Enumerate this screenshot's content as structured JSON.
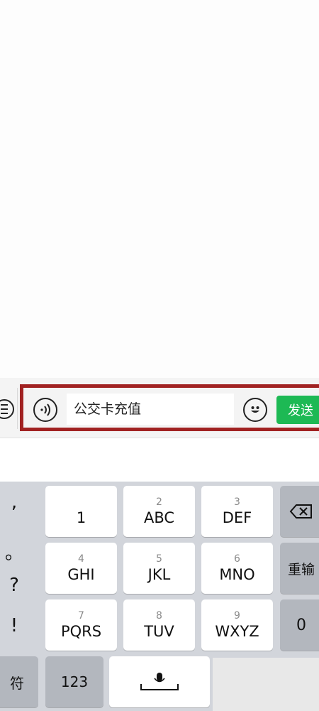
{
  "input_bar": {
    "text_value": "公交卡充值",
    "send_label": "发送"
  },
  "icons": {
    "menu": "menu-lines-icon",
    "voice": "voice-wave-icon",
    "emoji": "smiley-face-icon",
    "backspace": "backspace-icon",
    "mic": "microphone-icon"
  },
  "colors": {
    "send_button": "#1db954",
    "highlight_border": "#a12222",
    "keyboard_bg": "#d2d5db"
  },
  "keyboard": {
    "punctuation": [
      ",",
      "。",
      "?",
      "!"
    ],
    "keys": {
      "k1": {
        "digit": "",
        "letters": "1"
      },
      "k2": {
        "digit": "2",
        "letters": "ABC"
      },
      "k3": {
        "digit": "3",
        "letters": "DEF"
      },
      "k4": {
        "digit": "4",
        "letters": "GHI"
      },
      "k5": {
        "digit": "5",
        "letters": "JKL"
      },
      "k6": {
        "digit": "6",
        "letters": "MNO"
      },
      "k7": {
        "digit": "7",
        "letters": "PQRS"
      },
      "k8": {
        "digit": "8",
        "letters": "TUV"
      },
      "k9": {
        "digit": "9",
        "letters": "WXYZ"
      }
    },
    "reinput_label": "重输",
    "zero_label": "0",
    "symbol_label": "符",
    "numeric_label": "123"
  }
}
